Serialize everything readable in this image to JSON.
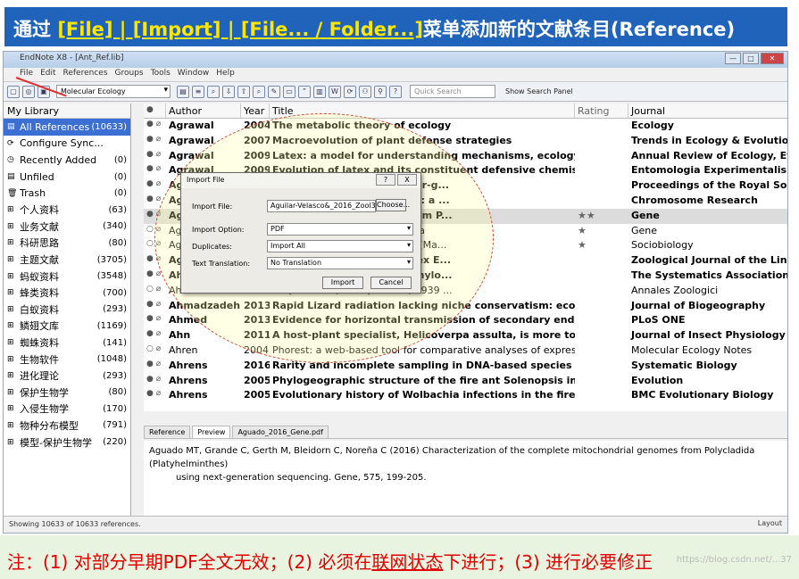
{
  "banner": {
    "pre": "通过 ",
    "highlight": "[File] | [Import] | [File... / Folder...]",
    "post": "菜单添加新的文献条目(Reference)"
  },
  "window": {
    "title": "EndNote X8 - [Ant_Ref.lib]",
    "controls": [
      "—",
      "□",
      "✕"
    ]
  },
  "menu": [
    "File",
    "Edit",
    "References",
    "Groups",
    "Tools",
    "Window",
    "Help"
  ],
  "toolbar": {
    "group": "Molecular Ecology",
    "search_placeholder": "Quick Search",
    "show_panel": "Show Search Panel"
  },
  "sidebar": {
    "title": "My Library",
    "items": [
      {
        "icon": "▤",
        "label": "All References",
        "count": "(10633)",
        "selected": true
      },
      {
        "icon": "⟳",
        "label": "Configure Sync...",
        "count": ""
      },
      {
        "icon": "◷",
        "label": "Recently Added",
        "count": "(0)"
      },
      {
        "icon": "▤",
        "label": "Unfiled",
        "count": "(0)"
      },
      {
        "icon": "🗑",
        "label": "Trash",
        "count": "(0)"
      },
      {
        "icon": "⊞",
        "label": "个人资料",
        "count": "(63)"
      },
      {
        "icon": "⊞",
        "label": "业务文献",
        "count": "(340)"
      },
      {
        "icon": "⊞",
        "label": "科研思路",
        "count": "(80)"
      },
      {
        "icon": "⊞",
        "label": "主题文献",
        "count": "(3705)"
      },
      {
        "icon": "⊞",
        "label": "蚂蚁资料",
        "count": "(3548)"
      },
      {
        "icon": "⊞",
        "label": "蜂类资料",
        "count": "(700)"
      },
      {
        "icon": "⊞",
        "label": "白蚁资料",
        "count": "(293)"
      },
      {
        "icon": "⊞",
        "label": "鳞翅文库",
        "count": "(1169)"
      },
      {
        "icon": "⊞",
        "label": "蜘蛛资料",
        "count": "(141)"
      },
      {
        "icon": "⊞",
        "label": "生物软件",
        "count": "(1048)"
      },
      {
        "icon": "⊞",
        "label": "进化理论",
        "count": "(293)"
      },
      {
        "icon": "⊞",
        "label": "保护生物学",
        "count": "(80)"
      },
      {
        "icon": "⊞",
        "label": "入侵生物学",
        "count": "(170)"
      },
      {
        "icon": "⊞",
        "label": "物种分布模型",
        "count": "(791)"
      },
      {
        "icon": "⊞",
        "label": "模型-保护生物学",
        "count": "(220)"
      }
    ]
  },
  "columns": [
    "●",
    "Author",
    "Year",
    "Title",
    "Rating",
    "Journal"
  ],
  "rows": [
    {
      "m": "● ⌀",
      "author": "Agrawal",
      "year": "2004",
      "title": "The metabolic theory of ecology",
      "rating": "",
      "journal": "Ecology",
      "bold": true
    },
    {
      "m": "● ⌀",
      "author": "Agrawal",
      "year": "2007",
      "title": "Macroevolution of plant defense strategies",
      "rating": "",
      "journal": "Trends in Ecology & Evolution",
      "bold": true
    },
    {
      "m": "● ⌀",
      "author": "Agrawal",
      "year": "2009",
      "title": "Latex: a model for understanding mechanisms, ecology, and evol...",
      "rating": "",
      "journal": "Annual Review of Ecology, Evolution",
      "bold": true
    },
    {
      "m": "● ⌀",
      "author": "Agrawal",
      "year": "2009",
      "title": "Evolution of latex and its constituent defensive chemistry in milk...",
      "rating": "",
      "journal": "Entomologia Experimentalis et Ap",
      "bold": true
    },
    {
      "m": "● ⌀",
      "author": "Ag",
      "year": "",
      "title": "process combining gene-for-g...",
      "rating": "",
      "journal": "Proceedings of the Royal Society I",
      "bold": true
    },
    {
      "m": "● ⌀",
      "author": "Ag",
      "year": "",
      "title": "e elements and their hosts: a ...",
      "rating": "",
      "journal": "Chromosome Research",
      "bold": true
    },
    {
      "m": "● ⌀",
      "author": "Ag",
      "year": "",
      "title": "mitochondrial genomes from P...",
      "rating": "★★",
      "journal": "Gene",
      "bold": true,
      "hl": true
    },
    {
      "m": "○ ⌀",
      "author": "Ag",
      "year": "",
      "title": "unusually variable for Annelida",
      "rating": "★",
      "journal": "Gene",
      "bold": false
    },
    {
      "m": "○ ⌀",
      "author": "Ag",
      "year": "",
      "title": "three species of Camponotus (Ma...",
      "rating": "★",
      "journal": "Sociobiology",
      "bold": false
    },
    {
      "m": "● ⌀",
      "author": "Ag",
      "year": "",
      "title": "the Neotropical ant complex E...",
      "rating": "",
      "journal": "Zoological Journal of the Linnean",
      "bold": true
    },
    {
      "m": "● ⌀",
      "author": "Ah",
      "year": "",
      "title": "volution: Palaeontology, Phylo...",
      "rating": "",
      "journal": "The Systematics Association Speci",
      "bold": true
    },
    {
      "m": "○ ⌀",
      "author": "Ah",
      "year": "",
      "title": "ud (Imamura, 1931) Thorne, 1939 ...",
      "rating": "",
      "journal": "Annales Zoologici",
      "bold": false
    },
    {
      "m": "● ⌀",
      "author": "Ahmadzadeh",
      "year": "2013",
      "title": "Rapid Lizard radiation lacking niche conservatism: ecological div...",
      "rating": "",
      "journal": "Journal of Biogeography",
      "bold": true
    },
    {
      "m": "● ⌀",
      "author": "Ahmed",
      "year": "2013",
      "title": "Evidence for horizontal transmission of secondary endosymbiont...",
      "rating": "",
      "journal": "PLoS ONE",
      "bold": true
    },
    {
      "m": "● ⌀",
      "author": "Ahn",
      "year": "2011",
      "title": "A host-plant specialist, Helicoverpa assulta, is more tolerant to c...",
      "rating": "",
      "journal": "Journal of Insect Physiology",
      "bold": true
    },
    {
      "m": "○ ⌀",
      "author": "Ahren",
      "year": "2004",
      "title": "Phorest: a web-based tool for comparative analyses of expressed seque...",
      "rating": "",
      "journal": "Molecular Ecology Notes",
      "bold": false
    },
    {
      "m": "● ⌀",
      "author": "Ahrens",
      "year": "2016",
      "title": "Rarity and incomplete sampling in DNA-based species delimitation",
      "rating": "",
      "journal": "Systematic Biology",
      "bold": true
    },
    {
      "m": "● ⌀",
      "author": "Ahrens",
      "year": "2005",
      "title": "Phylogeographic structure of the fire ant Solenopsis invicta in its...",
      "rating": "",
      "journal": "Evolution",
      "bold": true
    },
    {
      "m": "● ⌀",
      "author": "Ahrens",
      "year": "2005",
      "title": "Evolutionary history of Wolbachia infections in the fire ant Solen...",
      "rating": "",
      "journal": "BMC Evolutionary Biology",
      "bold": true
    }
  ],
  "tabs": [
    "Reference",
    "Preview",
    "Aguado_2016_Gene.pdf"
  ],
  "preview": {
    "line1": "Aguado MT, Grande C, Gerth M, Bleidorn C, Noreña C (2016) Characterization of the complete mitochondrial genomes from Polycladida (Platyhelminthes)",
    "line2": "using next-generation sequencing. Gene, 575, 199-205."
  },
  "status": {
    "text": "Showing 10633 of 10633 references.",
    "layout": "Layout"
  },
  "dialog": {
    "title": "Import File",
    "file_label": "Import File:",
    "file_value": "Aguilar-Velasco&_2016_Zool3LinnSoc.",
    "choose": "Choose...",
    "option_label": "Import Option:",
    "option_value": "PDF",
    "dup_label": "Duplicates:",
    "dup_value": "Import All",
    "trans_label": "Text Translation:",
    "trans_value": "No Translation",
    "import": "Import",
    "cancel": "Cancel",
    "help": "?",
    "close": "X"
  },
  "note": {
    "t1": "注：(1) 对部分早期PDF全文无效；(2) 必须在",
    "u": "联网状态",
    "t2": "下进行；(3) 进行必要修正"
  },
  "watermark": "https://blog.csdn.net/...37"
}
